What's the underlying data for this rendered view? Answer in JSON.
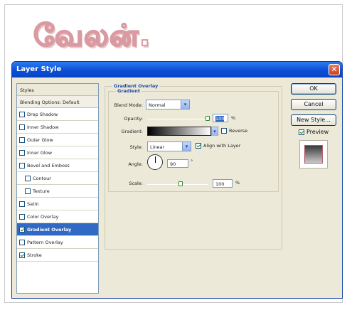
{
  "headline": "வேலன்.",
  "dialog": {
    "title": "Layer Style",
    "close_glyph": "✕"
  },
  "styles_list": {
    "header": "Styles",
    "blending": "Blending Options: Default",
    "items": [
      {
        "label": "Drop Shadow",
        "checked": false,
        "indent": false,
        "selected": false
      },
      {
        "label": "Inner Shadow",
        "checked": false,
        "indent": false,
        "selected": false
      },
      {
        "label": "Outer Glow",
        "checked": false,
        "indent": false,
        "selected": false
      },
      {
        "label": "Inner Glow",
        "checked": false,
        "indent": false,
        "selected": false
      },
      {
        "label": "Bevel and Emboss",
        "checked": false,
        "indent": false,
        "selected": false
      },
      {
        "label": "Contour",
        "checked": false,
        "indent": true,
        "selected": false
      },
      {
        "label": "Texture",
        "checked": false,
        "indent": true,
        "selected": false
      },
      {
        "label": "Satin",
        "checked": false,
        "indent": false,
        "selected": false
      },
      {
        "label": "Color Overlay",
        "checked": false,
        "indent": false,
        "selected": false
      },
      {
        "label": "Gradient Overlay",
        "checked": true,
        "indent": false,
        "selected": true
      },
      {
        "label": "Pattern Overlay",
        "checked": false,
        "indent": false,
        "selected": false
      },
      {
        "label": "Stroke",
        "checked": true,
        "indent": false,
        "selected": false
      }
    ]
  },
  "panel": {
    "section_title": "Gradient Overlay",
    "group_title": "Gradient",
    "blend_mode_label": "Blend Mode:",
    "blend_mode_value": "Normal",
    "opacity_label": "Opacity:",
    "opacity_value": "100",
    "opacity_unit": "%",
    "gradient_label": "Gradient:",
    "reverse_label": "Reverse",
    "reverse_checked": false,
    "style_label": "Style:",
    "style_value": "Linear",
    "align_label": "Align with Layer",
    "align_checked": true,
    "angle_label": "Angle:",
    "angle_value": "90",
    "angle_unit": "°",
    "scale_label": "Scale:",
    "scale_value": "100",
    "scale_unit": "%"
  },
  "buttons": {
    "ok": "OK",
    "cancel": "Cancel",
    "new_style": "New Style...",
    "preview": "Preview",
    "preview_checked": true
  },
  "colors": {
    "accent": "#316ac5",
    "titlebar": "#0a4fd6",
    "headline_outline": "#d99aa1"
  }
}
